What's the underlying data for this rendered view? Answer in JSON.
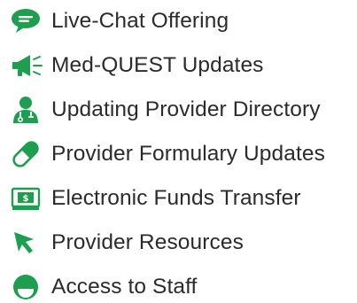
{
  "menu": {
    "items": [
      {
        "label": "Live-Chat Offering",
        "icon": "chat-bubble-icon"
      },
      {
        "label": "Med-QUEST Updates",
        "icon": "megaphone-icon"
      },
      {
        "label": "Updating Provider Directory",
        "icon": "doctor-icon"
      },
      {
        "label": "Provider Formulary Updates",
        "icon": "pill-icon"
      },
      {
        "label": "Electronic Funds Transfer",
        "icon": "money-bill-icon"
      },
      {
        "label": "Provider Resources",
        "icon": "cursor-arrow-icon"
      },
      {
        "label": "Access to Staff",
        "icon": "staff-headset-icon"
      }
    ]
  },
  "colors": {
    "icon_green": "#1e9e4f",
    "text": "#2b2b2b"
  }
}
